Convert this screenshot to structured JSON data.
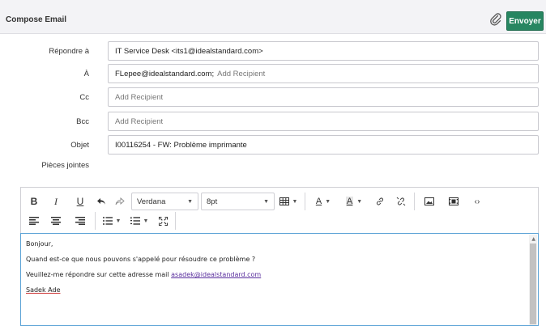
{
  "header": {
    "title": "Compose Email",
    "send_label": "Envoyer"
  },
  "fields": [
    {
      "label": "Répondre à",
      "value": "IT Service Desk <its1@idealstandard.com>",
      "placeholder": ""
    },
    {
      "label": "À",
      "value": "FLepee@idealstandard.com;",
      "placeholder": "Add Recipient"
    },
    {
      "label": "Cc",
      "value": "",
      "placeholder": "Add Recipient"
    },
    {
      "label": "Bcc",
      "value": "",
      "placeholder": "Add Recipient"
    },
    {
      "label": "Objet",
      "value": "I00116254 - FW: Problème imprimante",
      "placeholder": ""
    }
  ],
  "attachments": {
    "label": "Pièces jointes"
  },
  "toolbar": {
    "bold": "B",
    "italic": "I",
    "underline": "U",
    "font_family": "Verdana",
    "font_size": "8pt",
    "text_color_label": "A",
    "bg_color_label": "A"
  },
  "body": {
    "lines": [
      "Bonjour,",
      "Quand est-ce que nous pouvons s'appelé pour résoudre ce problème ?",
      "Veuillez-me répondre sur cette adresse mail"
    ],
    "link": "asadek@idealstandard.com",
    "signature": "Sadek Ade"
  }
}
